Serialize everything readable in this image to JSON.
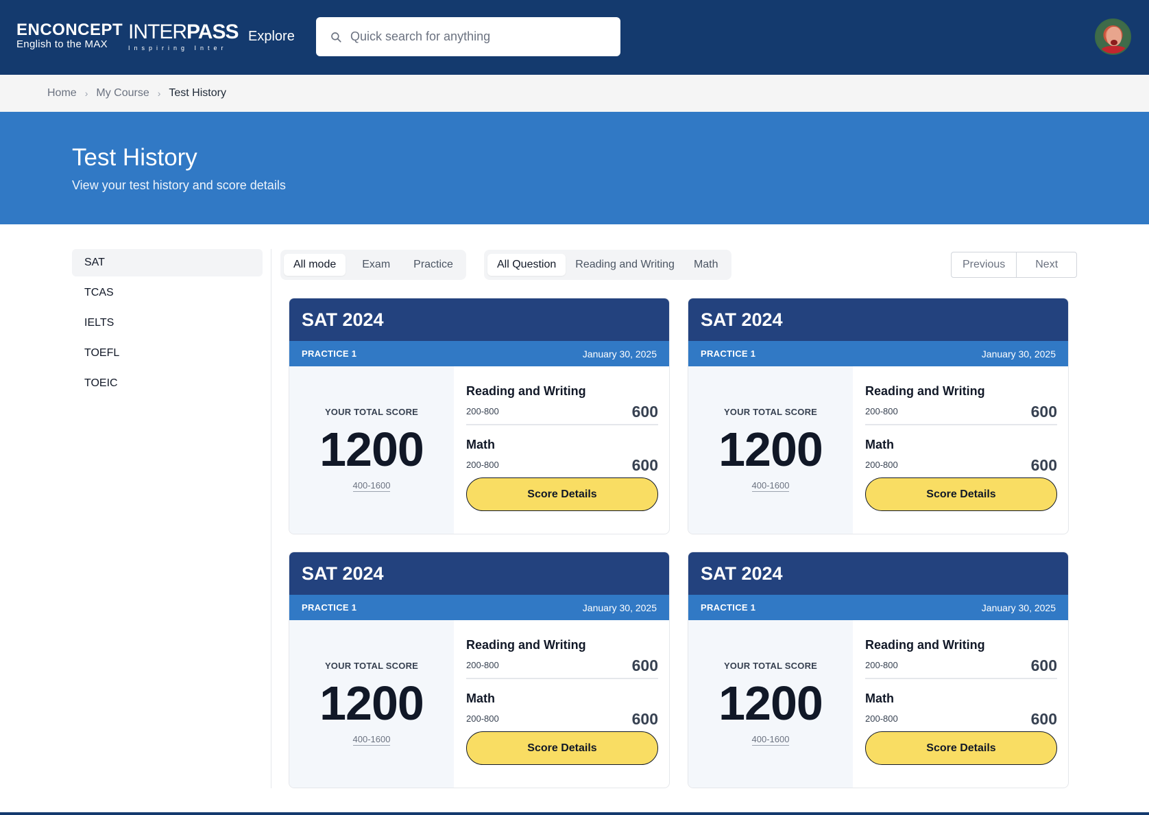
{
  "header": {
    "logo_enconcept": "ENCONCEPT",
    "logo_enconcept_tagline": "English to the MAX",
    "logo_interpass_a": "INTER",
    "logo_interpass_b": "PASS",
    "logo_interpass_tagline": "Inspiring Inter",
    "nav_explore": "Explore",
    "search_placeholder": "Quick search for anything",
    "search_icon": "search-icon",
    "avatar_icon": "user-avatar"
  },
  "breadcrumb": [
    "Home",
    "My Course",
    "Test History"
  ],
  "hero": {
    "title": "Test History",
    "subtitle": "View your test history and score details"
  },
  "sidebar": {
    "items": [
      {
        "label": "SAT",
        "active": true
      },
      {
        "label": "TCAS",
        "active": false
      },
      {
        "label": "IELTS",
        "active": false
      },
      {
        "label": "TOEFL",
        "active": false
      },
      {
        "label": "TOEIC",
        "active": false
      }
    ]
  },
  "filters": {
    "mode": [
      "All mode",
      "Exam",
      "Practice"
    ],
    "question": [
      "All Question",
      "Reading and Writing",
      "Math"
    ]
  },
  "pager": {
    "previous": "Previous",
    "next": "Next"
  },
  "cards": [
    {
      "title": "SAT 2024",
      "mode": "PRACTICE 1",
      "date": "January 30, 2025",
      "total_label": "YOUR TOTAL SCORE",
      "total": "1200",
      "total_range": "400-1600",
      "sections": [
        {
          "name": "Reading and Writing",
          "range": "200-800",
          "score": "600"
        },
        {
          "name": "Math",
          "range": "200-800",
          "score": "600"
        }
      ],
      "button": "Score Details"
    },
    {
      "title": "SAT 2024",
      "mode": "PRACTICE 1",
      "date": "January 30, 2025",
      "total_label": "YOUR TOTAL SCORE",
      "total": "1200",
      "total_range": "400-1600",
      "sections": [
        {
          "name": "Reading and Writing",
          "range": "200-800",
          "score": "600"
        },
        {
          "name": "Math",
          "range": "200-800",
          "score": "600"
        }
      ],
      "button": "Score Details"
    },
    {
      "title": "SAT 2024",
      "mode": "PRACTICE 1",
      "date": "January 30, 2025",
      "total_label": "YOUR TOTAL SCORE",
      "total": "1200",
      "total_range": "400-1600",
      "sections": [
        {
          "name": "Reading and Writing",
          "range": "200-800",
          "score": "600"
        },
        {
          "name": "Math",
          "range": "200-800",
          "score": "600"
        }
      ],
      "button": "Score Details"
    },
    {
      "title": "SAT 2024",
      "mode": "PRACTICE 1",
      "date": "January 30, 2025",
      "total_label": "YOUR TOTAL SCORE",
      "total": "1200",
      "total_range": "400-1600",
      "sections": [
        {
          "name": "Reading and Writing",
          "range": "200-800",
          "score": "600"
        },
        {
          "name": "Math",
          "range": "200-800",
          "score": "600"
        }
      ],
      "button": "Score Details"
    }
  ],
  "colors": {
    "header_bg": "#143a6e",
    "hero_bg": "#3179c5",
    "card_head_bg": "#23427e",
    "button_bg": "#f9dd63"
  }
}
